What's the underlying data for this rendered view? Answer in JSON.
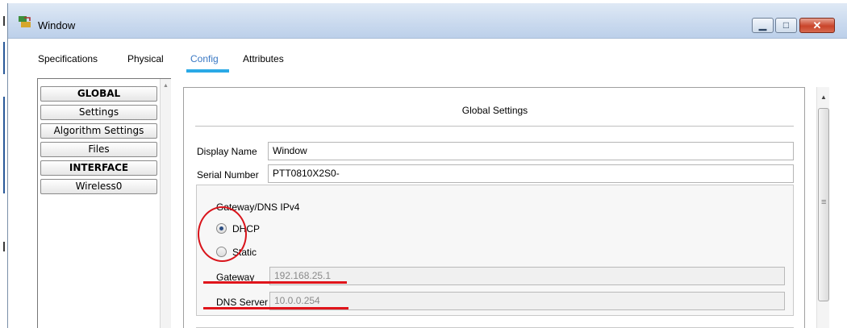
{
  "window": {
    "title": "Window",
    "icon": "packet-tracer-app-icon",
    "controls": [
      "minimize-icon",
      "maximize-icon",
      "close-icon"
    ]
  },
  "tabs": [
    {
      "label": "Specifications"
    },
    {
      "label": "Physical"
    },
    {
      "label": "Config",
      "active": true
    },
    {
      "label": "Attributes"
    }
  ],
  "sidebar": {
    "items": [
      {
        "label": "GLOBAL",
        "type": "header"
      },
      {
        "label": "Settings"
      },
      {
        "label": "Algorithm Settings"
      },
      {
        "label": "Files"
      },
      {
        "label": "INTERFACE",
        "type": "header"
      },
      {
        "label": "Wireless0"
      }
    ]
  },
  "global_settings": {
    "title": "Global Settings",
    "display_name_label": "Display Name",
    "display_name_value": "Window",
    "serial_number_label": "Serial Number",
    "serial_number_value": "PTT0810X2S0-",
    "gateway_dns": {
      "title": "Gateway/DNS IPv4",
      "dhcp_label": "DHCP",
      "static_label": "Static",
      "selected": "DHCP",
      "gateway_label": "Gateway",
      "gateway_value": "192.168.25.1",
      "dns_label": "DNS Server",
      "dns_value": "10.0.0.254"
    }
  },
  "colors": {
    "active_tab": "#3a78c4",
    "tab_underline": "#2aa9e6",
    "annotation": "#d9141b"
  }
}
